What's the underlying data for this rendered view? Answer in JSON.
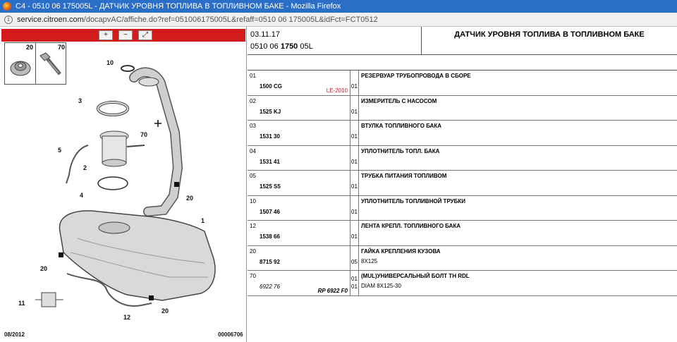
{
  "window": {
    "title": "C4 - 0510 06 175005L - ДАТЧИК УРОВНЯ ТОПЛИВА В ТОПЛИВНОМ БАКЕ - Mozilla Firefox"
  },
  "urlbar": {
    "host": "service.citroen.com",
    "path": "/docapvAC/affiche.do?ref=051006175005L&refaff=0510 06 175005L&idFct=FCT0512"
  },
  "diagram": {
    "zoom_in_label": "+",
    "zoom_out_label": "−",
    "zoom_fit_label": "⤢",
    "thumb_labels": [
      "20",
      "70"
    ],
    "callouts": [
      "10",
      "3",
      "70",
      "5",
      "2",
      "4",
      "20",
      "1",
      "20",
      "11",
      "12",
      "20"
    ],
    "footer_left": "08/2012",
    "footer_right": "00006706"
  },
  "header": {
    "date": "03.11.17",
    "ref_prefix": "0510 06 ",
    "ref_bold": "1750",
    "ref_suffix": " 05L",
    "title": "ДАТЧИК УРОВНЯ ТОПЛИВА В ТОПЛИВНОМ БАКЕ"
  },
  "parts": [
    {
      "idx": "01",
      "part": "1500 CG",
      "extra": "LE-2010",
      "qty": "01",
      "name": "РЕЗЕРВУАР ТРУБОПРОВОДА В СБОРЕ",
      "desc": ""
    },
    {
      "idx": "02",
      "part": "1525 KJ",
      "extra": "",
      "qty": "01",
      "name": "ИЗМЕРИТЕЛЬ С НАСОСОМ",
      "desc": ""
    },
    {
      "idx": "03",
      "part": "1531 30",
      "extra": "",
      "qty": "01",
      "name": "ВТУЛКА ТОПЛИВНОГО БАКА",
      "desc": ""
    },
    {
      "idx": "04",
      "part": "1531 41",
      "extra": "",
      "qty": "01",
      "name": "УПЛОТНИТЕЛЬ ТОПЛ. БАКА",
      "desc": ""
    },
    {
      "idx": "05",
      "part": "1525 S5",
      "extra": "",
      "qty": "01",
      "name": "ТРУБКА ПИТАНИЯ ТОПЛИВОМ",
      "desc": ""
    },
    {
      "idx": "10",
      "part": "1507 46",
      "extra": "",
      "qty": "01",
      "name": "УПЛОТНИТЕЛЬ ТОПЛИВНОЙ ТРУБКИ",
      "desc": ""
    },
    {
      "idx": "12",
      "part": "1538 66",
      "extra": "",
      "qty": "01",
      "name": "ЛЕНТА КРЕПЛ. ТОПЛИВНОГО БАКА",
      "desc": ""
    },
    {
      "idx": "20",
      "part": "8715 92",
      "extra": "",
      "qty": "05",
      "name": "ГАЙКА КРЕПЛЕНИЯ КУЗОВА",
      "desc": "8X125"
    },
    {
      "idx": "70",
      "part": "6922 76",
      "extra": "RP 6922 F0",
      "qty": "01",
      "qty2": "01",
      "name": "(MUL)УНИВЕРСАЛЬНЫЙ БОЛТ TH RDL",
      "desc": "DIAM 8X125-30"
    }
  ]
}
